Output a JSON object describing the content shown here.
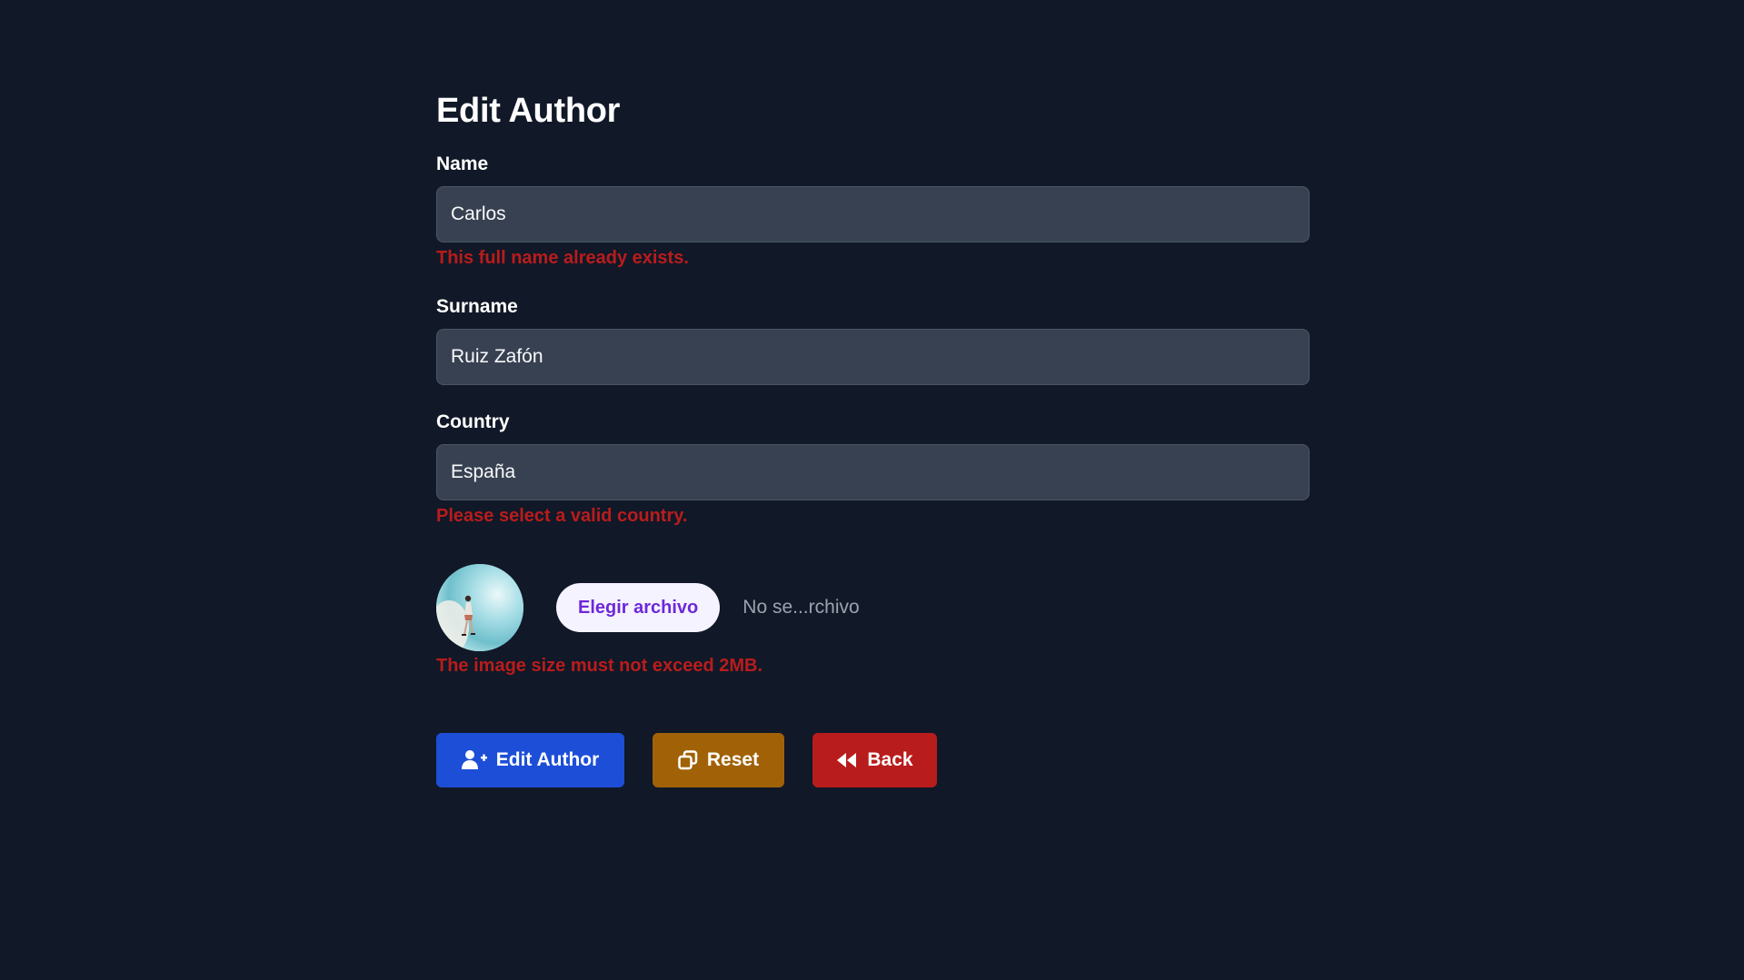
{
  "form": {
    "title": "Edit Author",
    "name": {
      "label": "Name",
      "value": "Carlos",
      "error": "This full name already exists."
    },
    "surname": {
      "label": "Surname",
      "value": "Ruiz Zafón"
    },
    "country": {
      "label": "Country",
      "value": "España",
      "error": "Please select a valid country."
    },
    "image": {
      "choose_label": "Elegir archivo",
      "status": "No se...rchivo",
      "error": "The image size must not exceed 2MB."
    }
  },
  "actions": {
    "edit": {
      "label": "Edit Author",
      "icon": "user-plus-icon"
    },
    "reset": {
      "label": "Reset",
      "icon": "clone-icon"
    },
    "back": {
      "label": "Back",
      "icon": "backward-icon"
    }
  },
  "colors": {
    "background": "#111827",
    "input_bg": "#374151",
    "error": "#b91c1c",
    "edit_button": "#1d4ed8",
    "reset_button": "#a16207",
    "back_button": "#b91c1c",
    "file_button_bg": "#f5f3ff",
    "file_button_text": "#6d28d9"
  }
}
